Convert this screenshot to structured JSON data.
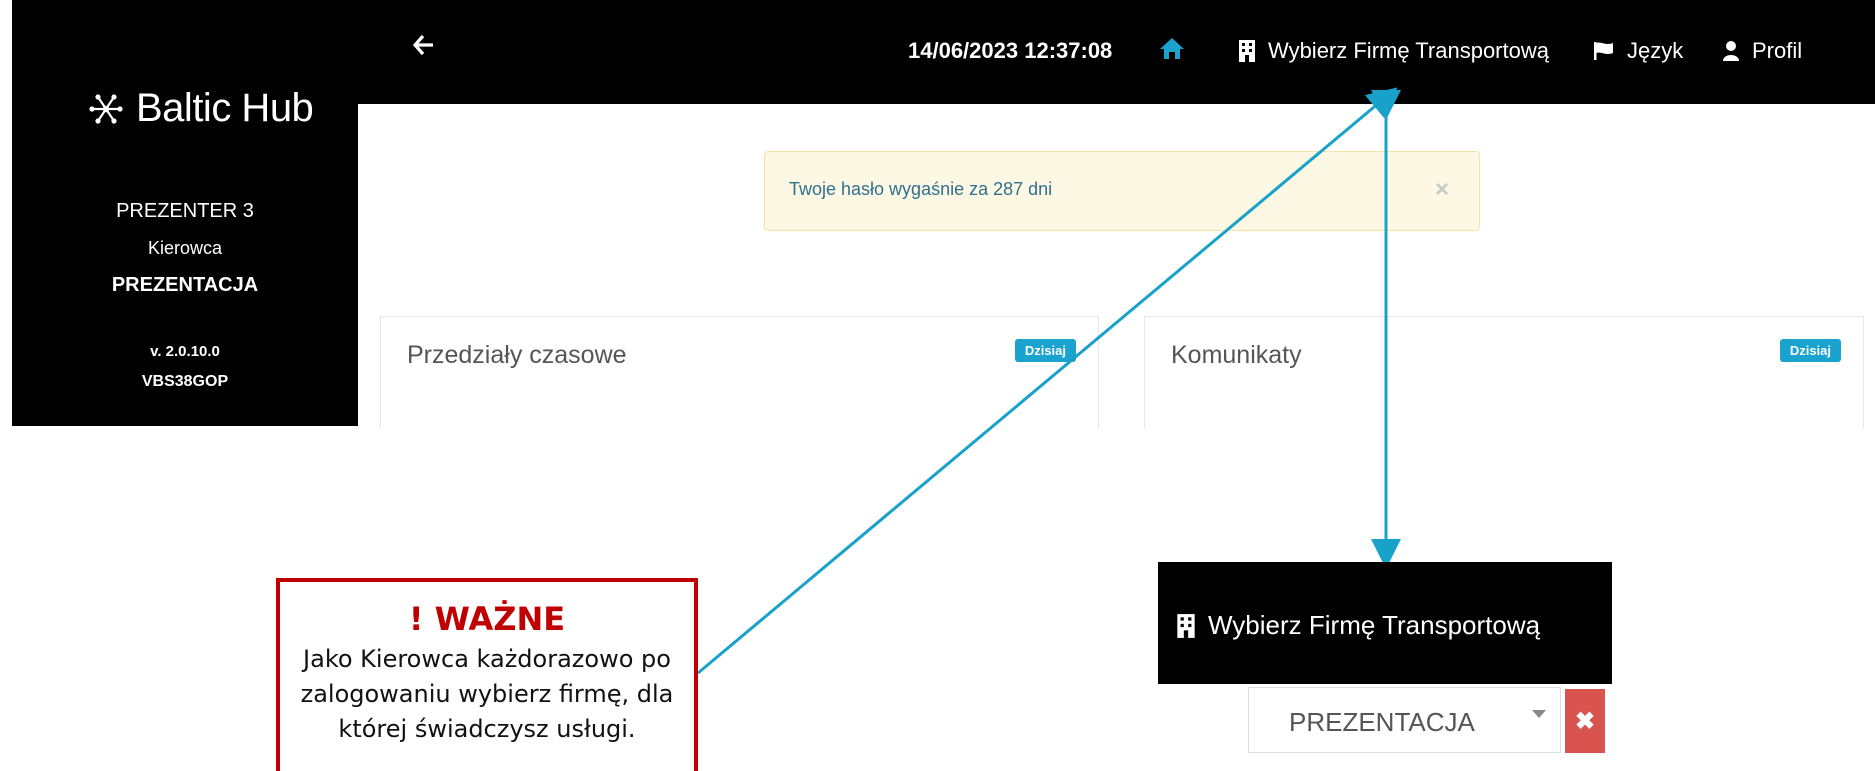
{
  "sidebar": {
    "brand": "Baltic Hub",
    "user_name": "PREZENTER 3",
    "role": "Kierowca",
    "company": "PREZENTACJA",
    "version": "v. 2.0.10.0",
    "code": "VBS38GOP"
  },
  "topbar": {
    "back_icon": "arrow-left-icon",
    "datetime": "14/06/2023 12:37:08",
    "home_icon": "home-icon",
    "company_select_label": "Wybierz Firmę Transportową",
    "language_label": "Język",
    "profile_label": "Profil"
  },
  "alert": {
    "text": "Twoje hasło wygaśnie za 287 dni",
    "close": "×"
  },
  "panels": [
    {
      "title": "Przedziały czasowe",
      "badge": "Dzisiaj"
    },
    {
      "title": "Komunikaty",
      "badge": "Dzisiaj"
    }
  ],
  "callout": {
    "title": "! WAŻNE",
    "lines": [
      "Jako Kierowca każdorazowo po",
      "zalogowaniu wybierz firmę, dla",
      "której świadczysz usługi."
    ]
  },
  "zoom": {
    "label": "Wybierz Firmę Transportową",
    "selected": "PREZENTACJA",
    "clear": "✖"
  },
  "colors": {
    "accent": "#1ba3cf",
    "warning_bg": "#fcf8e3",
    "alert_text": "#31708f",
    "important": "#c00000",
    "danger": "#d9534f"
  }
}
